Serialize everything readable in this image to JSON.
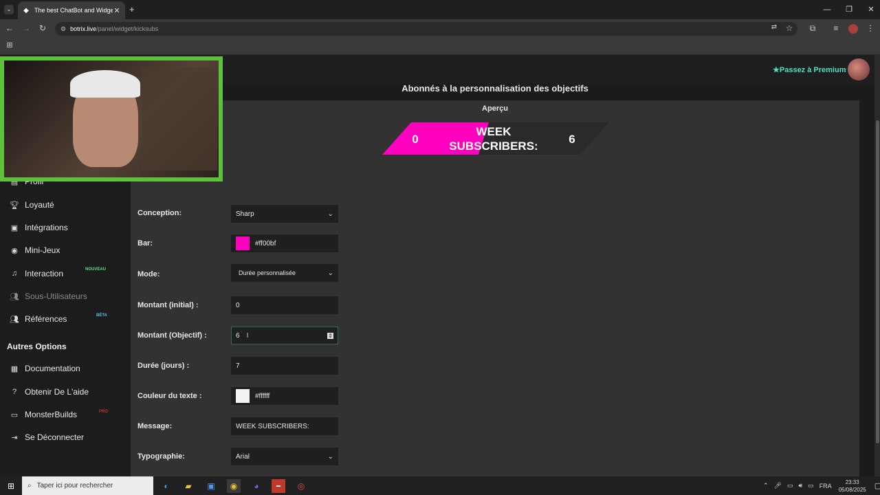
{
  "browser": {
    "tab_title": "The best ChatBot and Widgets",
    "url_domain": "botrix.live",
    "url_path": "/panel/widget/kicksubs"
  },
  "header": {
    "premium_label": "Passez à Premium"
  },
  "sidebar": {
    "items": [
      {
        "label": "Profil",
        "icon": "user-card-icon"
      },
      {
        "label": "Loyauté",
        "icon": "trophy-icon"
      },
      {
        "label": "Intégrations",
        "icon": "plug-icon"
      },
      {
        "label": "Mini-Jeux",
        "icon": "gamepad-icon"
      },
      {
        "label": "Interaction",
        "icon": "music-icon",
        "badge": "NOUVEAU"
      },
      {
        "label": "Sous-Utilisateurs",
        "icon": "users-icon",
        "disabled": true
      },
      {
        "label": "Références",
        "icon": "users-icon",
        "badge": "BÉTA"
      }
    ],
    "section_title": "Autres Options",
    "other_items": [
      {
        "label": "Documentation",
        "icon": "scroll-icon"
      },
      {
        "label": "Obtenir De L'aide",
        "icon": "question-icon"
      },
      {
        "label": "MonsterBuilds",
        "icon": "laptop-icon",
        "badge": "PRO"
      },
      {
        "label": "Se Déconnecter",
        "icon": "logout-icon"
      }
    ]
  },
  "main": {
    "title": "Abonnés à la personnalisation des objectifs",
    "preview_label": "Aperçu",
    "goal_preview": {
      "start": "0",
      "text_line1": "WEEK",
      "text_line2": "SUBSCRIBERS:",
      "target": "6",
      "bar_color": "#ff00bf",
      "text_color": "#ffffff",
      "progress": 0
    },
    "form": {
      "design_label": "Conception:",
      "design_value": "Sharp",
      "bar_label": "Bar:",
      "bar_value": "#ff00bf",
      "mode_label": "Mode:",
      "mode_value": "Durée personnalisée",
      "initial_label": "Montant (initial) :",
      "initial_value": "0",
      "goal_label": "Montant (Objectif) :",
      "goal_value": "6",
      "duration_label": "Durée (jours) :",
      "duration_value": "7",
      "text_color_label": "Couleur du texte :",
      "text_color_value": "#ffffff",
      "message_label": "Message:",
      "message_value": "WEEK SUBSCRIBERS:",
      "font_label": "Typographie:",
      "font_value": "Arial"
    }
  },
  "taskbar": {
    "search_placeholder": "Taper ici pour rechercher",
    "lang": "FRA",
    "time": "23:33",
    "date": "05/08/2025"
  }
}
